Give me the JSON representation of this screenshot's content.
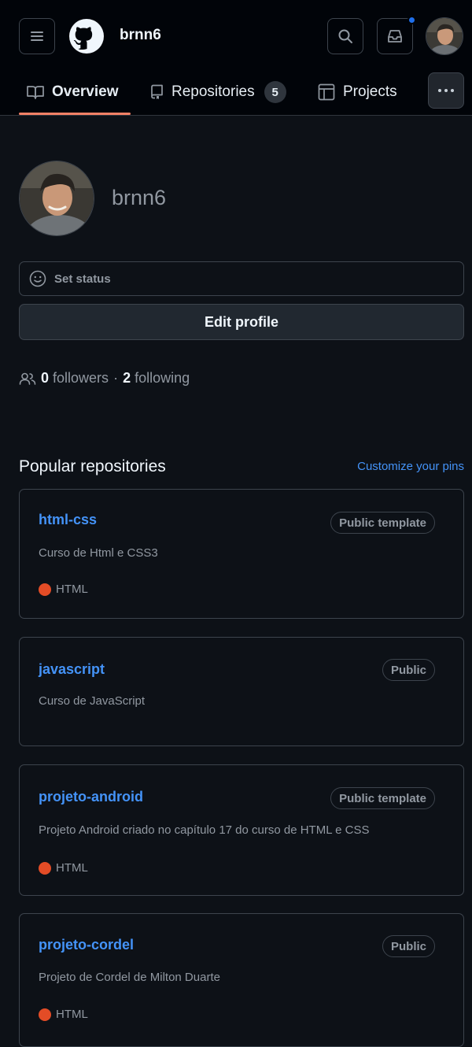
{
  "header": {
    "username": "brnn6",
    "has_notification": true
  },
  "tabs": [
    {
      "label": "Overview",
      "icon": "book-icon",
      "selected": true
    },
    {
      "label": "Repositories",
      "icon": "repo-icon",
      "count": "5"
    },
    {
      "label": "Projects",
      "icon": "table-icon"
    }
  ],
  "profile": {
    "name": "brnn6",
    "status_placeholder": "Set status",
    "edit_label": "Edit profile",
    "followers_count": "0",
    "followers_label": "followers",
    "separator": "·",
    "following_count": "2",
    "following_label": "following"
  },
  "popular": {
    "title": "Popular repositories",
    "customize_label": "Customize your pins",
    "repos": [
      {
        "name": "html-css",
        "badge": "Public template",
        "description": "Curso de Html e CSS3",
        "language": "HTML",
        "language_color": "#e34c26"
      },
      {
        "name": "javascript",
        "badge": "Public",
        "description": "Curso de JavaScript",
        "language": "",
        "language_color": ""
      },
      {
        "name": "projeto-android",
        "badge": "Public template",
        "description": "Projeto Android criado no capítulo 17 do curso de HTML e CSS",
        "language": "HTML",
        "language_color": "#e34c26"
      },
      {
        "name": "projeto-cordel",
        "badge": "Public",
        "description": "Projeto de Cordel de Milton Duarte",
        "language": "HTML",
        "language_color": "#e34c26"
      }
    ]
  }
}
